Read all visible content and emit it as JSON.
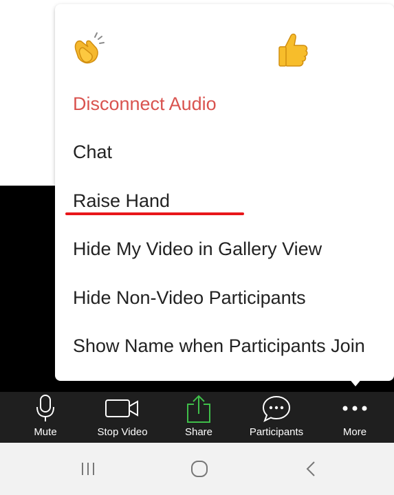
{
  "reactions": [
    {
      "name": "clap",
      "icon": "clapping-hands-icon"
    },
    {
      "name": "thumbs_up",
      "icon": "thumbs-up-icon"
    }
  ],
  "menu": {
    "items": [
      {
        "label": "Disconnect Audio"
      },
      {
        "label": "Chat"
      },
      {
        "label": "Raise Hand"
      },
      {
        "label": "Hide My Video in Gallery View"
      },
      {
        "label": "Hide Non-Video Participants"
      },
      {
        "label": "Show Name when Participants Join"
      }
    ]
  },
  "toolbar": {
    "buttons": [
      {
        "label": "Mute",
        "icon": "microphone-icon"
      },
      {
        "label": "Stop Video",
        "icon": "video-camera-icon"
      },
      {
        "label": "Share",
        "icon": "share-icon"
      },
      {
        "label": "Participants",
        "icon": "chat-bubble-icon"
      },
      {
        "label": "More",
        "icon": "more-dots-icon"
      }
    ]
  },
  "navbar": {
    "buttons": [
      {
        "icon": "recent-apps-icon"
      },
      {
        "icon": "home-icon"
      },
      {
        "icon": "back-icon"
      }
    ]
  },
  "colors": {
    "danger": "#d9534f",
    "share_green": "#3fbf4a",
    "toolbar_bg": "#1f1f1f",
    "highlight_underline": "#e8161a"
  }
}
